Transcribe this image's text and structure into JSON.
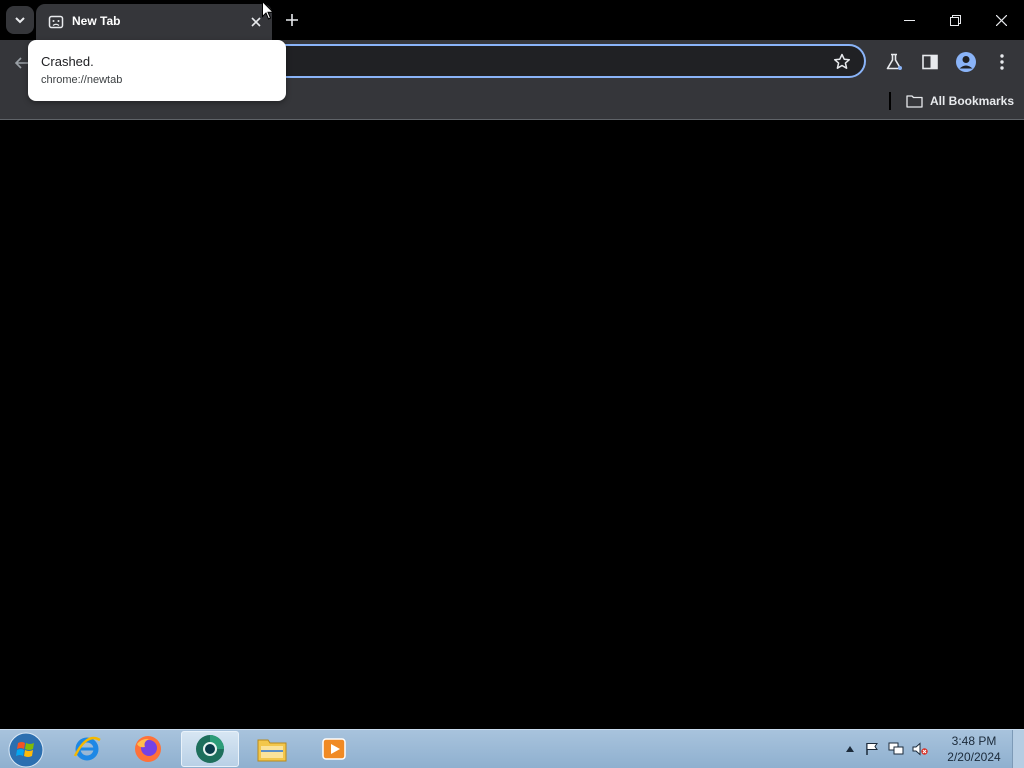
{
  "browser": {
    "tab": {
      "title": "New Tab"
    },
    "omnibox": {
      "value": ""
    },
    "bookmarks": {
      "all_label": "All Bookmarks"
    }
  },
  "hovercard": {
    "title": "Crashed.",
    "url": "chrome://newtab"
  },
  "taskbar": {
    "apps": [
      "internet-explorer",
      "firefox",
      "chrome-dev",
      "file-explorer",
      "media-player"
    ],
    "clock": {
      "time": "3:48 PM",
      "date": "2/20/2024"
    }
  },
  "colors": {
    "accent": "#8ab4f8",
    "toolbar": "#35363a",
    "content": "#000000"
  }
}
